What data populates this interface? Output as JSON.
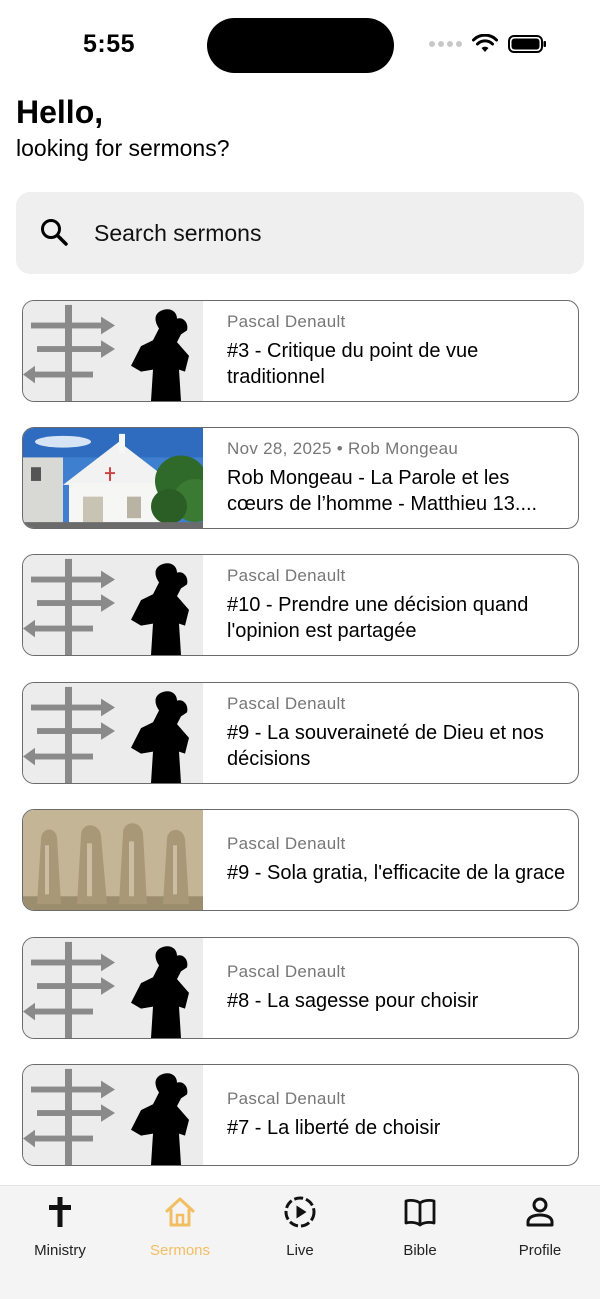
{
  "status_bar": {
    "time": "5:55"
  },
  "greeting": {
    "title": "Hello,",
    "subtitle": "looking for sermons?"
  },
  "search": {
    "placeholder": "Search sermons"
  },
  "sermons": [
    {
      "meta": "Pascal Denault",
      "title": "#3 - Critique du point de vue traditionnel",
      "thumb": "silhouette"
    },
    {
      "meta": "Nov 28, 2025 • Rob Mongeau",
      "title": "Rob Mongeau - La Parole et les cœurs de l’homme - Matthieu 13....",
      "thumb": "church"
    },
    {
      "meta": "Pascal Denault",
      "title": "#10 - Prendre une décision quand l'opinion est partagée",
      "thumb": "silhouette"
    },
    {
      "meta": "Pascal Denault",
      "title": "#9 - La souveraineté de Dieu et nos décisions",
      "thumb": "silhouette"
    },
    {
      "meta": "Pascal Denault",
      "title": "#9 - Sola gratia, l'efficacite de la grace",
      "thumb": "statues"
    },
    {
      "meta": "Pascal Denault",
      "title": "#8 - La sagesse pour choisir",
      "thumb": "silhouette"
    },
    {
      "meta": "Pascal Denault",
      "title": "#7 - La liberté de choisir",
      "thumb": "silhouette"
    }
  ],
  "tabs": [
    {
      "label": "Ministry",
      "icon": "cross-icon",
      "active": false
    },
    {
      "label": "Sermons",
      "icon": "home-icon",
      "active": true
    },
    {
      "label": "Live",
      "icon": "play-circle-icon",
      "active": false
    },
    {
      "label": "Bible",
      "icon": "book-icon",
      "active": false
    },
    {
      "label": "Profile",
      "icon": "person-icon",
      "active": false
    }
  ],
  "colors": {
    "accent": "#f2be63",
    "card_border": "#6b6b6b",
    "search_bg": "#efefef",
    "tabbar_bg": "#f4f4f4"
  }
}
